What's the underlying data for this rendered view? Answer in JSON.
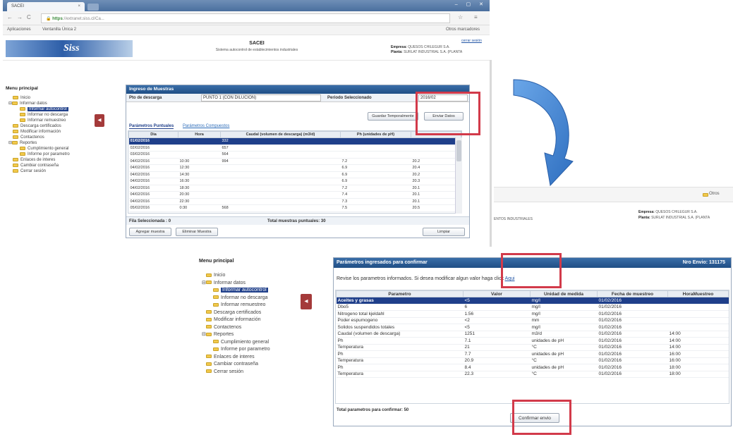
{
  "browser": {
    "tab_title": "SACEI",
    "tab_close": "×",
    "url_secure": "https",
    "url_rest": "://extranet.siss.cl/Ca...",
    "bookmarks": [
      "Aplicaciones",
      "Ventanilla Única 2"
    ],
    "other_bookmarks": "Otros marcadores"
  },
  "header": {
    "logo": "Siss",
    "system_title": "SACEI",
    "system_subtitle": "Sistema autocontrol de establecimientos industriales",
    "user_link": "cerrar sesión",
    "empresa_label": "Empresa:",
    "empresa_value": "QUESOS CHILEGUR S.A.",
    "planta_label": "Planta:",
    "planta_value": "SURLAT INDUSTRIAL S.A. (PLANTA"
  },
  "menu": {
    "title": "Menu principal",
    "items": [
      {
        "label": "Inicio"
      },
      {
        "label": "Informar datos"
      },
      {
        "label": "Informar autocontrol",
        "selected": true
      },
      {
        "label": "Informar no descarga"
      },
      {
        "label": "Informar remuestreo"
      },
      {
        "label": "Descarga certificados"
      },
      {
        "label": "Modificar información"
      },
      {
        "label": "Contactenos"
      },
      {
        "label": "Reportes"
      },
      {
        "label": "Cumplimiento general"
      },
      {
        "label": "Informe por parametro"
      },
      {
        "label": "Enlaces de interes"
      },
      {
        "label": "Cambiar contraseña"
      },
      {
        "label": "Cerrar sesión"
      }
    ]
  },
  "ingreso": {
    "title": "Ingreso de Muestras",
    "pto_label": "Pto de descarga",
    "pto_value": "PUNTO 1 (CON DILUCION)",
    "periodo_label": "Periodo Seleccionado",
    "periodo_value": "2016/02",
    "btn_guardar": "Guardar Temporalmente",
    "btn_enviar": "Enviar Datos",
    "tab_puntuales": "Parámetros Puntuales",
    "tab_compuestos": "Parámetros Compuestos",
    "columns": [
      "Dia",
      "Hora",
      "Caudal (volumen de descarga) (m3/d)",
      "Ph (unidades de pH)",
      ""
    ],
    "rows": [
      [
        "01/02/2016",
        "",
        "332",
        "",
        ""
      ],
      [
        "02/02/2016",
        "",
        "657",
        "",
        ""
      ],
      [
        "03/02/2016",
        "",
        "564",
        "",
        ""
      ],
      [
        "04/02/2016",
        "10:30",
        "994",
        "7.2",
        "20.2"
      ],
      [
        "04/02/2016",
        "12:30",
        "",
        "6.9",
        "20.4"
      ],
      [
        "04/02/2016",
        "14:30",
        "",
        "6.9",
        "20.2"
      ],
      [
        "04/02/2016",
        "16:30",
        "",
        "6.9",
        "20.3"
      ],
      [
        "04/02/2016",
        "18:30",
        "",
        "7.2",
        "20.1"
      ],
      [
        "04/02/2016",
        "20:30",
        "",
        "7.4",
        "20.1"
      ],
      [
        "04/02/2016",
        "22:30",
        "",
        "7.3",
        "20.1"
      ],
      [
        "05/02/2016",
        "0:30",
        "568",
        "7.5",
        "20.5"
      ]
    ],
    "fila_label": "Fila Seleccionada : 0",
    "total_label": "Total muestras puntuales: 30",
    "btn_agregar": "Agregar muestra",
    "btn_eliminar": "Eliminar Muestra",
    "btn_limpiar": "Limpiar"
  },
  "fragment": {
    "other_bookmarks": "Otros",
    "text_left": "ENTOS INDUSTRIALES"
  },
  "confirm": {
    "title": "Parámetros ingresados para confirmar",
    "envio_label": "Nro Envio: 131175",
    "instruction": "Revise los parametros informados. Si desea modificar algun valor haga click",
    "link": "Aqui",
    "columns": [
      "Parametro",
      "Valor",
      "Unidad de medida",
      "Fecha de muestreo",
      "HoraMuestreo"
    ],
    "rows": [
      [
        "Aceites y grasas",
        "<5",
        "mg/l",
        "01/02/2016",
        ""
      ],
      [
        "Dbo5",
        "6",
        "mg/l",
        "01/02/2016",
        ""
      ],
      [
        "Nitrogeno total kjeldahl",
        "1.56",
        "mg/l",
        "01/02/2016",
        ""
      ],
      [
        "Poder espumogeno",
        "<2",
        "mm",
        "01/02/2016",
        ""
      ],
      [
        "Solidos suspendidos totales",
        "<5",
        "mg/l",
        "01/02/2016",
        ""
      ],
      [
        "Caudal (volumen de descarga)",
        "1251",
        "m3/d",
        "01/02/2016",
        "14:00"
      ],
      [
        "Ph",
        "7.1",
        "unidades de pH",
        "01/02/2016",
        "14:00"
      ],
      [
        "Temperatura",
        "21",
        "°C",
        "01/02/2016",
        "14:00"
      ],
      [
        "Ph",
        "7.7",
        "unidades de pH",
        "01/02/2016",
        "16:00"
      ],
      [
        "Temperatura",
        "20.9",
        "°C",
        "01/02/2016",
        "16:00"
      ],
      [
        "Ph",
        "8.4",
        "unidades de pH",
        "01/02/2016",
        "18:00"
      ],
      [
        "Temperatura",
        "22.3",
        "°C",
        "01/02/2016",
        "18:00"
      ]
    ],
    "total_label": "Total parametros para confirmar: 50",
    "btn_confirmar": "Confirmar envio"
  },
  "colors": {
    "panel_header": "#1f4e85",
    "selection": "#1f3f8a",
    "highlight_box": "#d23a4a",
    "arrow": "#2f6fc0"
  },
  "icons": [
    "folder-icon",
    "collapse-arrow-icon",
    "back-icon",
    "forward-icon",
    "reload-icon",
    "lock-icon",
    "star-icon",
    "menu-icon",
    "curved-arrow-icon"
  ]
}
